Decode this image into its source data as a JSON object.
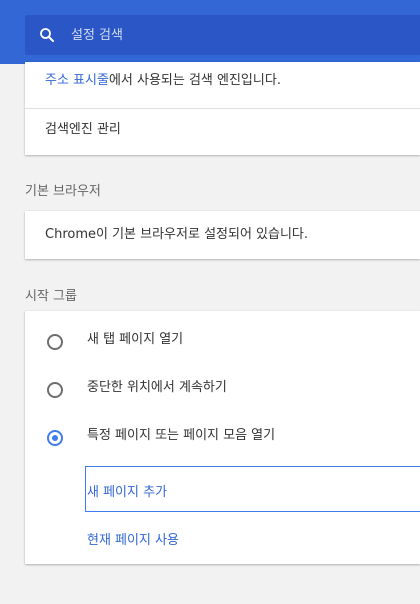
{
  "colors": {
    "header": "#3367d6",
    "search_box": "#2a56c6",
    "accent": "#3f7cf1",
    "link": "#3367d6",
    "background": "#f2f2f2"
  },
  "header": {
    "search_placeholder": "설정 검색",
    "search_icon": "search-icon"
  },
  "search_engine": {
    "address_bar_link": "주소 표시줄",
    "description_suffix": "에서 사용되는 검색 엔진입니다.",
    "manage_label": "검색엔진 관리"
  },
  "default_browser": {
    "title": "기본 브라우저",
    "status": "Chrome이 기본 브라우저로 설정되어 있습니다."
  },
  "startup": {
    "title": "시작 그룹",
    "options": [
      {
        "label": "새 탭 페이지 열기",
        "checked": false
      },
      {
        "label": "중단한 위치에서 계속하기",
        "checked": false
      },
      {
        "label": "특정 페이지 또는 페이지 모음 열기",
        "checked": true
      }
    ],
    "add_page": "새 페이지 추가",
    "use_current": "현재 페이지 사용"
  }
}
